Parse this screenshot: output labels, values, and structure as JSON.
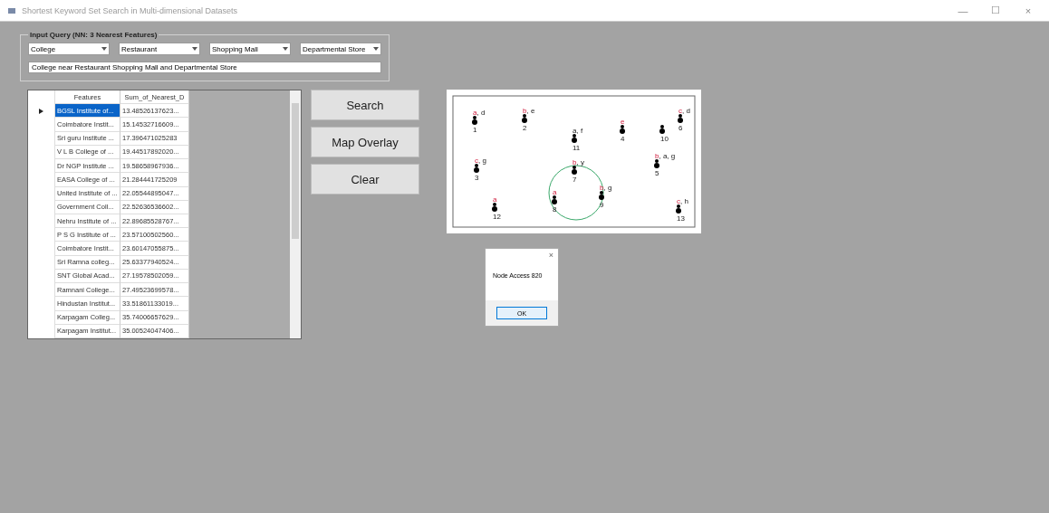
{
  "window": {
    "title": "Shortest Keyword Set Search in Multi-dimensional Datasets"
  },
  "query_group": {
    "title": "Input Query (NN: 3 Nearest Features)",
    "dropdowns": [
      "College",
      "Restaurant",
      "Shopping Mall",
      "Departmental Store"
    ],
    "query_text": "College near Restaurant Shopping Mall and Departmental Store"
  },
  "table": {
    "columns": [
      "Features",
      "Sum_of_Nearest_D"
    ],
    "rows": [
      {
        "cells": [
          "BGSL Institute of...",
          "13.48526137623..."
        ],
        "selected": true
      },
      {
        "cells": [
          "Coimbatore Instit...",
          "15.14532716609..."
        ],
        "selected": false
      },
      {
        "cells": [
          "Sri guru Institute ...",
          "17.396471025283"
        ],
        "selected": false
      },
      {
        "cells": [
          "V L B College of ...",
          "19.44517892020..."
        ],
        "selected": false
      },
      {
        "cells": [
          "Dr NGP Institute ...",
          "19.58658967936..."
        ],
        "selected": false
      },
      {
        "cells": [
          "EASA College of ...",
          "21.284441725209"
        ],
        "selected": false
      },
      {
        "cells": [
          "United Institute of ...",
          "22.05544895047..."
        ],
        "selected": false
      },
      {
        "cells": [
          "Government Coll...",
          "22.52636536602..."
        ],
        "selected": false
      },
      {
        "cells": [
          "Nehru Institute of ...",
          "22.89685528767..."
        ],
        "selected": false
      },
      {
        "cells": [
          "P S G Institute of ...",
          "23.57100502560..."
        ],
        "selected": false
      },
      {
        "cells": [
          "Coimbatore Instit...",
          "23.60147055875..."
        ],
        "selected": false
      },
      {
        "cells": [
          "Sri Ramna colleg...",
          "25.63377940524..."
        ],
        "selected": false
      },
      {
        "cells": [
          "SNT Global Acad...",
          "27.19578502059..."
        ],
        "selected": false
      },
      {
        "cells": [
          "Ramnani College...",
          "27.49523699578..."
        ],
        "selected": false
      },
      {
        "cells": [
          "Hindustan Institut...",
          "33.51861133019..."
        ],
        "selected": false
      },
      {
        "cells": [
          "Karpagam Colleg...",
          "35.74006657629..."
        ],
        "selected": false
      },
      {
        "cells": [
          "Karpagam Institut...",
          "35.00524047406..."
        ],
        "selected": false
      }
    ]
  },
  "buttons": [
    "Search",
    "Map Overlay",
    "Clear"
  ],
  "map": {
    "nodes": [
      {
        "label": "1",
        "keywords": "a",
        "extra": ", d"
      },
      {
        "label": "2",
        "keywords": "b",
        "extra": ", e"
      },
      {
        "label": "11",
        "extra": "a, f"
      },
      {
        "label": "4",
        "keywords": "e"
      },
      {
        "label": "10"
      },
      {
        "label": "6",
        "keywords": "c",
        "extra": ", d"
      },
      {
        "label": "3",
        "keywords": "c",
        "extra": ", g"
      },
      {
        "label": "5",
        "keywords": "b",
        "extra": ", a, g"
      },
      {
        "label": "7",
        "keywords": "b",
        "extra": ", y"
      },
      {
        "label": "8",
        "keywords": "a"
      },
      {
        "label": "9",
        "keywords": "b",
        "extra": ", g"
      },
      {
        "label": "13",
        "keywords": "c",
        "extra": ", h"
      },
      {
        "label": "12",
        "keywords": "a"
      }
    ]
  },
  "message_box": {
    "close": "×",
    "text": "Node Access 820",
    "button": "OK"
  },
  "title_controls": [
    "—",
    "☐",
    "×"
  ]
}
